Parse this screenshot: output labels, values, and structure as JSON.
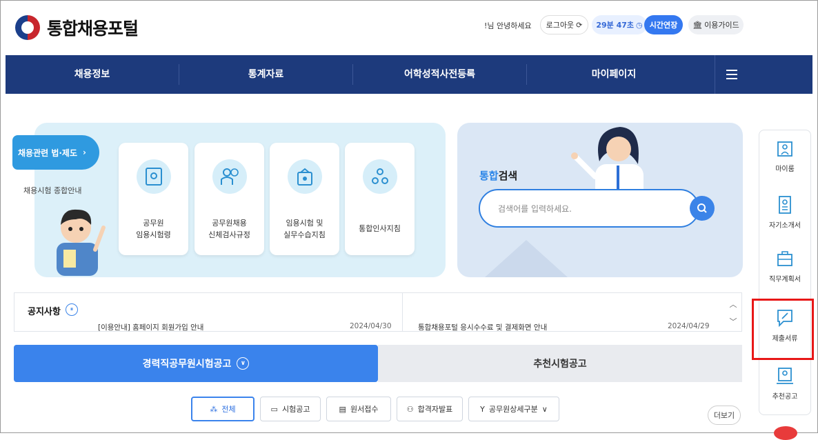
{
  "header": {
    "logo_text": "통합채용포털",
    "greeting": "!님 안녕하세요",
    "logout": "로그아웃",
    "timer": "29분 47초",
    "extend": "시간연장",
    "guide": "이용가이드"
  },
  "nav": {
    "items": [
      {
        "label": "채용정보"
      },
      {
        "label": "통계자료"
      },
      {
        "label": "어학성적사전등록"
      },
      {
        "label": "마이페이지"
      }
    ],
    "menu_icon": "hamburger-icon"
  },
  "left_panel": {
    "law_button": "채용관련 법·제도",
    "subtitle": "채용시험 종합안내",
    "cards": [
      {
        "label": "공무원\n임용시험령",
        "icon": "book-icon"
      },
      {
        "label": "공무원채용\n신체검사규정",
        "icon": "person-check-icon"
      },
      {
        "label": "임용시험 및\n실무수습지침",
        "icon": "exam-icon"
      },
      {
        "label": "통합인사지침",
        "icon": "people-icon"
      }
    ]
  },
  "search": {
    "title_accent": "통합",
    "title_rest": "검색",
    "placeholder": "검색어를 입력하세요.",
    "button_icon": "search-icon"
  },
  "notice": {
    "title": "공지사항",
    "items": [
      {
        "text": "[이용안내] 홈페이지 회원가입 안내",
        "date": "2024/04/30"
      },
      {
        "text": "통합채용포털 응시수수료 및 결제화면 안내",
        "date": "2024/04/29"
      }
    ]
  },
  "tabs": {
    "active": "경력직공무원시험공고",
    "other": "추천시험공고"
  },
  "filters": [
    {
      "label": "전체",
      "icon": "grid-dots-icon"
    },
    {
      "label": "시험공고",
      "icon": "document-icon"
    },
    {
      "label": "원서접수",
      "icon": "form-icon"
    },
    {
      "label": "합격자발표",
      "icon": "people-icon"
    },
    {
      "label": "공무원상세구분",
      "icon": "branch-icon"
    }
  ],
  "more": "더보기",
  "quick_menu": [
    {
      "label": "마이룸",
      "icon": "my-room-icon"
    },
    {
      "label": "자기소개서",
      "icon": "resume-icon"
    },
    {
      "label": "직무계획서",
      "icon": "briefcase-icon"
    },
    {
      "label": "제출서류",
      "icon": "submit-document-icon"
    },
    {
      "label": "추천공고",
      "icon": "recommend-icon"
    }
  ],
  "colors": {
    "nav_bg": "#1d3a7c",
    "accent": "#3a83ec",
    "highlight": "#e81717"
  }
}
